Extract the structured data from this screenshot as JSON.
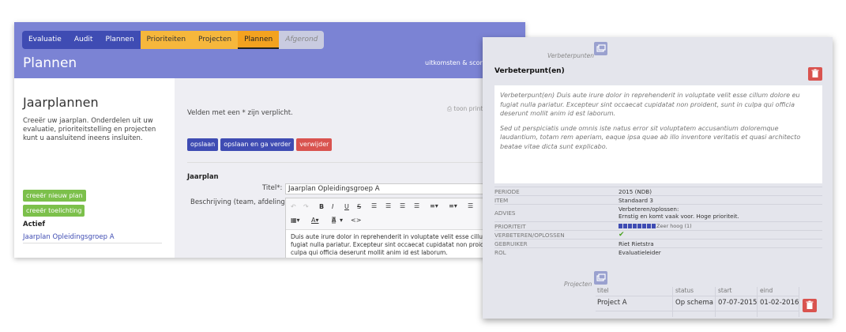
{
  "back_window": {
    "breadcrumbs": [
      {
        "label": "Evaluatie",
        "style": "blue"
      },
      {
        "label": "Audit",
        "style": "blue"
      },
      {
        "label": "Plannen",
        "style": "blue"
      },
      {
        "label": "Prioriteiten",
        "style": "orange"
      },
      {
        "label": "Projecten",
        "style": "orange"
      },
      {
        "label": "Plannen",
        "style": "orange-active"
      },
      {
        "label": "Afgerond",
        "style": "disabled"
      }
    ],
    "page_title": "Plannen",
    "top_right_text": "uitkomsten & scor",
    "left_panel": {
      "title": "Jaarplannen",
      "description": "Creeër uw jaarplan. Onderdelen uit uw evaluatie, prioriteitstelling en projecten kunt u aansluitend ineens insluiten.",
      "btn_new_plan": "creeër nieuw plan",
      "btn_explanation": "creeër toelichting",
      "active_label": "Actief",
      "active_link": "Jaarplan Opleidingsgroep A"
    },
    "main": {
      "required_note": "Velden met een * zijn verplicht.",
      "print_link": "toon print",
      "btn_save": "opslaan",
      "btn_save_continue": "opslaan en ga verder",
      "btn_delete": "verwijder",
      "section_title": "Jaarplan",
      "title_label": "Titel*:",
      "title_value": "Jaarplan Opleidingsgroep A",
      "description_label": "Beschrijving (team, afdeling):",
      "editor_text": "Duis aute irure dolor in reprehenderit in voluptate velit esse cillum dolore eu fugiat nulla pariatur. Excepteur sint occaecat cupidatat non proident, sunt in culpa qui officia deserunt mollit anim id est laborum."
    }
  },
  "front_window": {
    "section_label_top": "Verbeterpunten",
    "title": "Verbeterpunt(en)",
    "textbox": {
      "paragraph1": "Verbeterpunt(en) Duis aute irure dolor in reprehenderit in voluptate velit esse cillum dolore eu fugiat nulla pariatur. Excepteur sint occaecat cupidatat non proident, sunt in culpa qui officia deserunt mollit anim id est laborum.",
      "paragraph2": "Sed ut perspiciatis unde omnis iste natus error sit voluptatem accusantium doloremque laudantium, totam rem aperiam, eaque ipsa quae ab illo inventore veritatis et quasi architecto beatae vitae dicta sunt explicabo."
    },
    "details": {
      "periode_key": "PERIODE",
      "periode_value": "2015 (NDB)",
      "item_key": "ITEM",
      "item_value": "Standaard 3",
      "advies_key": "ADVIES",
      "advies_value1": "Verbeteren/oplossen:",
      "advies_value2": "Ernstig en komt vaak voor. Hoge prioriteit.",
      "prioriteit_key": "PRIORITEIT",
      "prioriteit_text": "Zeer hoog (1)",
      "prioriteit_level": 1.0,
      "verbeteren_key": "VERBETEREN/OPLOSSEN",
      "verbeteren_value": "✔",
      "gebruiker_key": "GEBRUIKER",
      "gebruiker_value": "Riet Rietstra",
      "rol_key": "ROL",
      "rol_value": "Evaluatieleider"
    },
    "section_label_projects": "Projecten",
    "projects_table": {
      "headers": [
        "titel",
        "status",
        "start",
        "eind"
      ],
      "rows": [
        [
          "Project A",
          "Op schema",
          "07-07-2015",
          "01-02-2016"
        ]
      ]
    }
  }
}
